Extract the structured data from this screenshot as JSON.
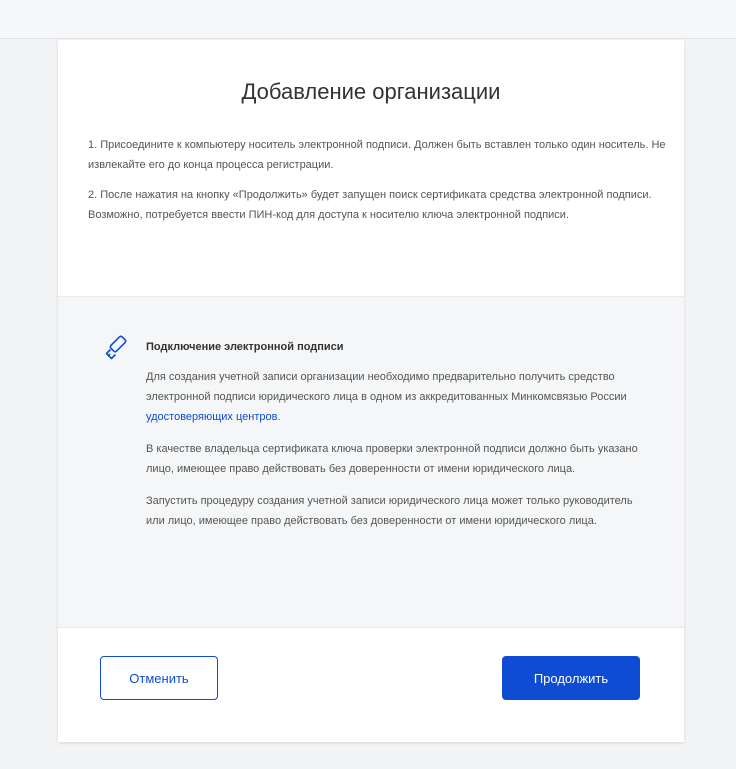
{
  "dialog": {
    "title": "Добавление организации",
    "intro_paragraphs": [
      "1. Присоедините к компьютеру носитель электронной подписи. Должен быть вставлен только один носитель. Не извлекайте его до конца процесса регистрации.",
      "2. После нажатия на кнопку «Продолжить» будет запущен поиск сертификата средства электронной подписи. Возможно, потребуется ввести ПИН-код для доступа к носителю ключа электронной подписи."
    ]
  },
  "info": {
    "icon": "usb-key-icon",
    "heading": "Подключение электронной подписи",
    "p1_text": "Для создания учетной записи организации необходимо предварительно получить средство электронной подписи юридического лица в одном из аккредитованных Минкомсвязью России ",
    "p1_link": "удостоверяющих центров",
    "p1_end": ".",
    "p2": "В качестве владельца сертификата ключа проверки электронной подписи должно быть указано лицо, имеющее право действовать без доверенности от имени юридического лица.",
    "p3": "Запустить процедуру создания учетной записи юридического лица может только руководитель или лицо, имеющее право действовать без доверенности от имени юридического лица."
  },
  "actions": {
    "cancel_label": "Отменить",
    "continue_label": "Продолжить"
  },
  "colors": {
    "accent": "#0d4cd3",
    "panel_bg": "#f5f6f7"
  }
}
